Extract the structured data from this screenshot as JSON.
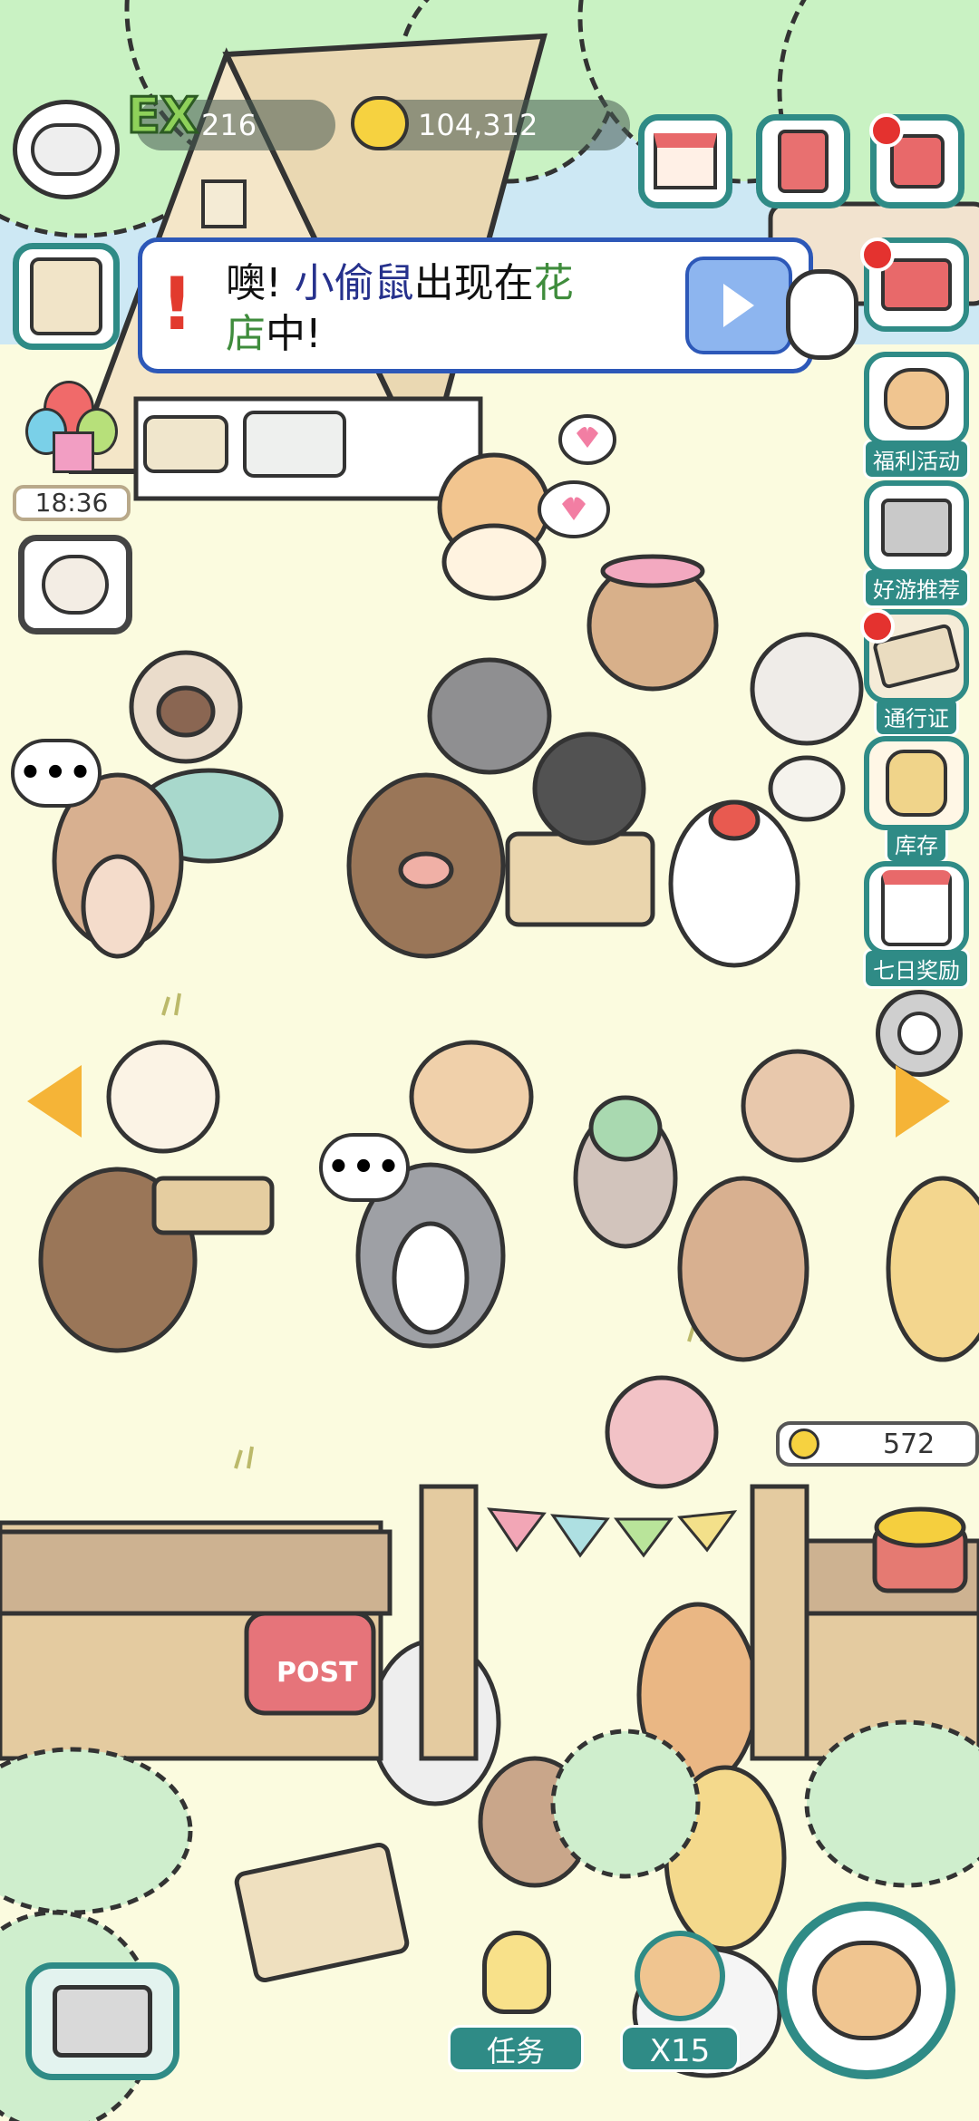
{
  "hud": {
    "exp_label": "EX",
    "exp_value": "216",
    "coins_value": "104,312",
    "coin_icon": "coin-icon",
    "timer": "18:36"
  },
  "notice": {
    "exclaim": "!",
    "line1_prefix": "噢! ",
    "line1_highlight": "小偷鼠",
    "line1_mid": "出现在",
    "line1_place": "花",
    "line2_place": "店",
    "line2_suffix": "中!",
    "highlight_color": "#26318c",
    "place_color": "#3f8c3c"
  },
  "side_menu": [
    {
      "label": "福利活动",
      "icon": "cat-megaphone-icon"
    },
    {
      "label": "好游推荐",
      "icon": "cat-box-icon"
    },
    {
      "label": "通行证",
      "icon": "pass-ticket-icon"
    },
    {
      "label": "库存",
      "icon": "backpack-icon"
    },
    {
      "label": "七日奖励",
      "icon": "calendar-icon"
    }
  ],
  "coin_stand": {
    "value": "572"
  },
  "bottom": {
    "task_label": "任务",
    "multiplier_label": "X15"
  },
  "bubbles": {
    "dots": "•••"
  },
  "colors": {
    "accent": "#2f8b86",
    "notice_border": "#2d58b8",
    "ground": "#fbfbdf",
    "tree": "#c9f2c3"
  }
}
